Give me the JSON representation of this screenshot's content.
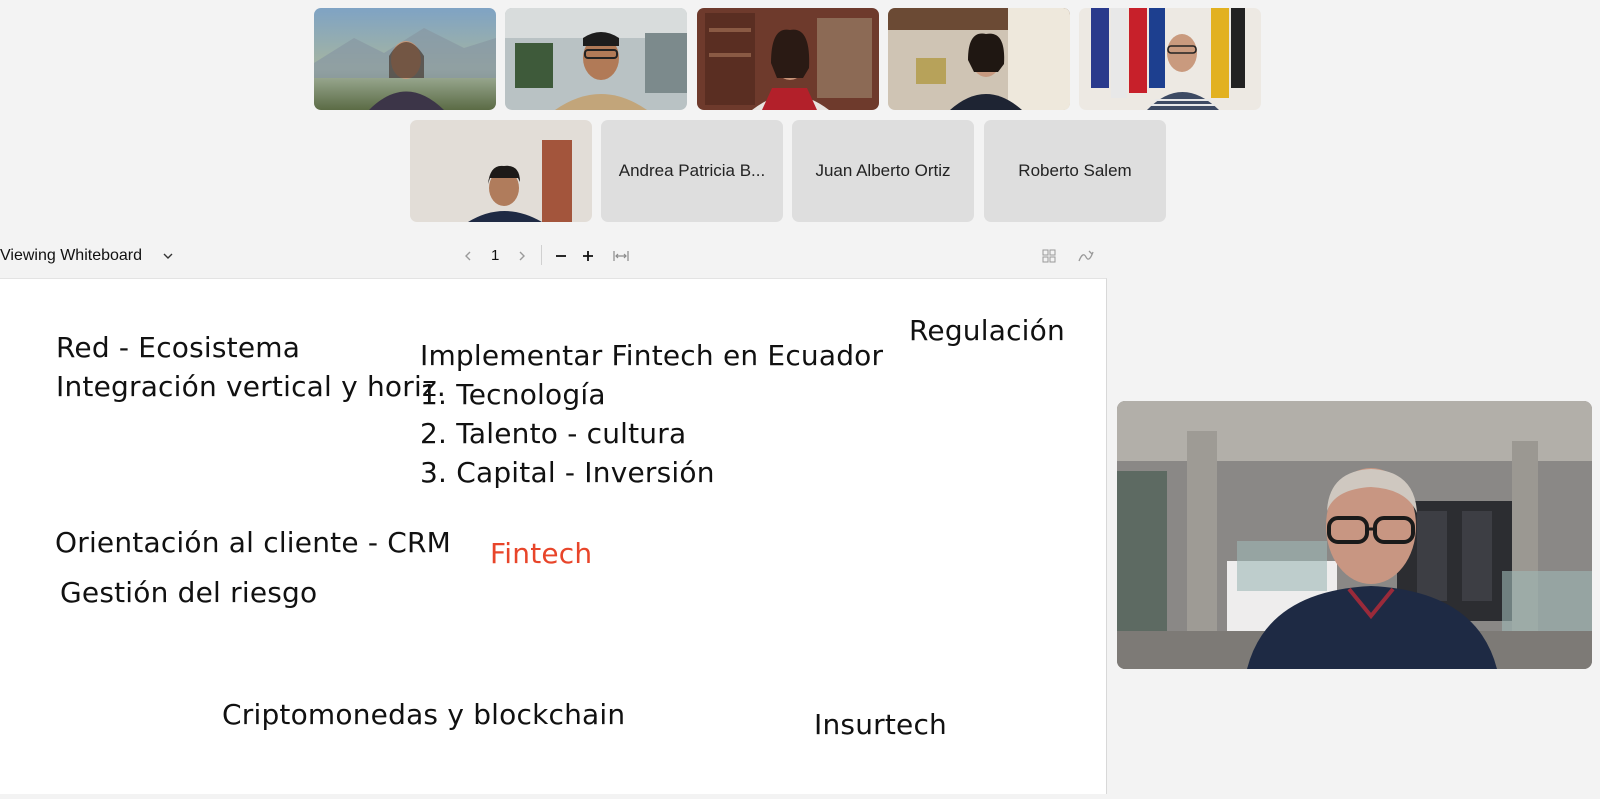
{
  "participants": {
    "video_tiles": [
      {
        "id": "p1",
        "desc": "participant-1"
      },
      {
        "id": "p2",
        "desc": "participant-2"
      },
      {
        "id": "p3",
        "desc": "participant-3"
      },
      {
        "id": "p4",
        "desc": "participant-4"
      },
      {
        "id": "p5",
        "desc": "participant-5"
      },
      {
        "id": "p6",
        "desc": "participant-6"
      }
    ],
    "name_tiles": [
      "Andrea Patricia B...",
      "Juan Alberto Ortiz",
      "Roberto Salem"
    ]
  },
  "toolbar": {
    "viewing_label": "Viewing Whiteboard",
    "page_number": "1",
    "icons": [
      "chevron-down-icon",
      "prev-page-icon",
      "next-page-icon",
      "zoom-out-icon",
      "zoom-in-icon",
      "fit-width-icon",
      "grid-view-icon",
      "annotate-icon"
    ]
  },
  "whiteboard": {
    "left_column": {
      "line1": "Red - Ecosistema",
      "line2": "Integración vertical y horiz."
    },
    "center_list": {
      "heading": "Implementar Fintech en Ecuador",
      "items": [
        "1. Tecnología",
        "2. Talento - cultura",
        "3. Capital - Inversión"
      ]
    },
    "top_right": "Regulación",
    "customer": "Orientación al cliente - CRM",
    "center_word": "Fintech",
    "risk": "Gestión del riesgo",
    "crypto": "Criptomonedas y blockchain",
    "insurtech": "Insurtech",
    "colors": {
      "accent": "#e8452a",
      "text": "#111111"
    }
  }
}
